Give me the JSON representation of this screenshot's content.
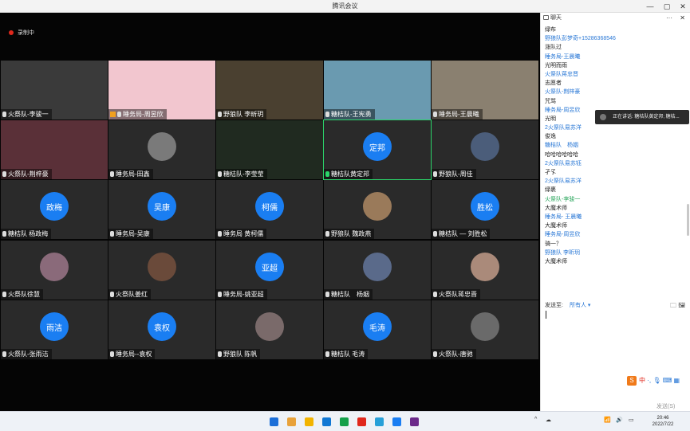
{
  "window": {
    "title": "腾讯会议",
    "min": "—",
    "max": "▢",
    "close": "✕"
  },
  "recording": {
    "label": "录制中"
  },
  "tiles": [
    {
      "name": "火祭队-李骏一",
      "kind": "video"
    },
    {
      "name": "睡务局-周昱欣",
      "kind": "video",
      "host": true
    },
    {
      "name": "野狼队 李昕玥",
      "kind": "video"
    },
    {
      "name": "糖桔队-王宪勇",
      "kind": "video"
    },
    {
      "name": "睡务局-王晨曦",
      "kind": "video"
    },
    {
      "name": "火祭队-荆梓豪",
      "kind": "video"
    },
    {
      "name": "睡务局-田鑫",
      "kind": "photo"
    },
    {
      "name": "糖桔队-李莹莹",
      "kind": "video"
    },
    {
      "name": "糖桔队黄定邦",
      "kind": "text",
      "avatar": "定邦",
      "speaking": true
    },
    {
      "name": "野狼队-周佳",
      "kind": "photo"
    },
    {
      "name": "糖桔队 杨政梅",
      "kind": "text",
      "avatar": "政梅"
    },
    {
      "name": "睡务局-吴康",
      "kind": "text",
      "avatar": "吴康"
    },
    {
      "name": "睡务局 黄柯儒",
      "kind": "text",
      "avatar": "柯儒"
    },
    {
      "name": "野狼队 魏政燕",
      "kind": "photo"
    },
    {
      "name": "糖桔队 — 刘胜松",
      "kind": "text",
      "avatar": "胜松"
    },
    {
      "name": "火祭队徐慧",
      "kind": "photo"
    },
    {
      "name": "火祭队姜红",
      "kind": "photo"
    },
    {
      "name": "睡务局-姚亚超",
      "kind": "text",
      "avatar": "亚超"
    },
    {
      "name": "糖桔队　杨姻",
      "kind": "photo"
    },
    {
      "name": "火祭队蒋忠晋",
      "kind": "photo"
    },
    {
      "name": "火祭队-张雨洁",
      "kind": "text",
      "avatar": "雨洁"
    },
    {
      "name": "睡务局--袁权",
      "kind": "text",
      "avatar": "袁权"
    },
    {
      "name": "野狼队 陈帆",
      "kind": "photo"
    },
    {
      "name": "糖桔队 毛涛",
      "kind": "text",
      "avatar": "毛涛"
    },
    {
      "name": "火祭队-唐驰",
      "kind": "photo"
    }
  ],
  "chat": {
    "title": "聊天",
    "more": "···",
    "close": "✕",
    "messages": [
      {
        "t": "t",
        "text": "绿布"
      },
      {
        "t": "s",
        "text": "野狼队彭梦奇+15286368546"
      },
      {
        "t": "t",
        "text": "涨队过"
      },
      {
        "t": "s",
        "text": "睡务局-王晨曦"
      },
      {
        "t": "t",
        "text": "光明而雨"
      },
      {
        "t": "s",
        "text": "火祭队蒋忠晋"
      },
      {
        "t": "t",
        "text": "志愿者"
      },
      {
        "t": "s",
        "text": "火祭队-荆梓豪"
      },
      {
        "t": "t",
        "text": "咒骂"
      },
      {
        "t": "s",
        "text": "睡务局-周昱欣"
      },
      {
        "t": "t",
        "text": "光明"
      },
      {
        "t": "s",
        "text": "2火祭队易苏洋"
      },
      {
        "t": "t",
        "text": "俊逸"
      },
      {
        "t": "s",
        "text": "糖桔队　杨姻"
      },
      {
        "t": "t",
        "text": "哈哈哈哈哈哈"
      },
      {
        "t": "s",
        "text": "2火祭队易苏钰"
      },
      {
        "t": "t",
        "text": "孑孓"
      },
      {
        "t": "s",
        "text": "2火祭队易苏洋"
      },
      {
        "t": "t",
        "text": "绿裹"
      },
      {
        "t": "s",
        "text": "火祭队-李骏一",
        "g": true
      },
      {
        "t": "t",
        "text": "大魔术师"
      },
      {
        "t": "s",
        "text": "睡务局- 王晨曦"
      },
      {
        "t": "t",
        "text": "大魔术师"
      },
      {
        "t": "s",
        "text": "睡务局-周昱欣"
      },
      {
        "t": "t",
        "text": "骑一？"
      },
      {
        "t": "s",
        "text": "野狼队 李昕玥"
      },
      {
        "t": "t",
        "text": "大魔术师"
      }
    ],
    "toast": "正在讲话: 糖桔队黄定邦; 糖桔...",
    "send_to_label": "发送至:",
    "send_to_value": "所有人 ▾",
    "send_button": "发送(S)"
  },
  "ime": {
    "s": "S",
    "lang": "中"
  },
  "taskbar": {
    "time": "20:46",
    "date": "2022/7/22",
    "icon_colors": [
      "#1c6fd8",
      "#e8a23a",
      "#f2b400",
      "#1178d4",
      "#14a04a",
      "#e0281c",
      "#27a0d8",
      "#1a7ef2",
      "#6b2a8a"
    ]
  }
}
